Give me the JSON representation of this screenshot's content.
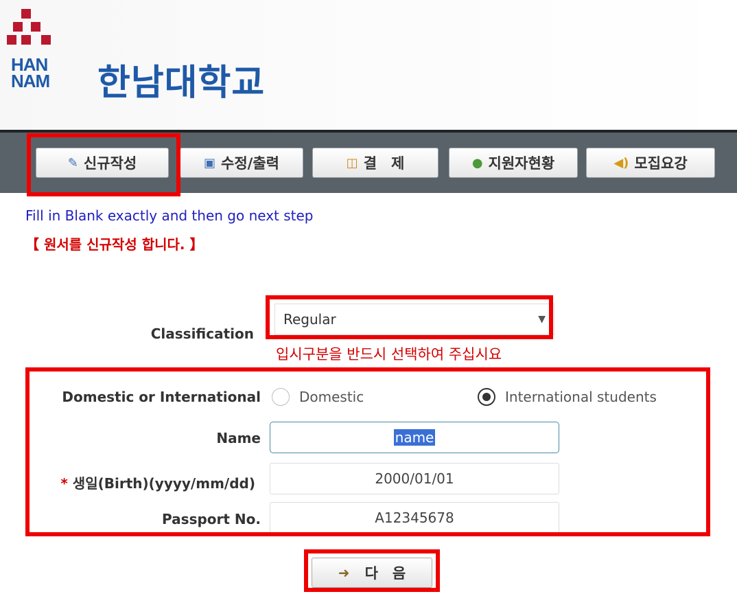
{
  "logo": {
    "abbr_line1": "HAN",
    "abbr_line2": "NAM",
    "name": "한남대학교",
    "brand_red": "#b9182f",
    "brand_blue": "#1f5aa8"
  },
  "toolbar": {
    "buttons": [
      {
        "label": "신규작성",
        "icon": "edit-icon"
      },
      {
        "label": "수정/출력",
        "icon": "document-edit-icon"
      },
      {
        "label": "결　제",
        "icon": "payment-icon"
      },
      {
        "label": "지원자현황",
        "icon": "people-icon"
      },
      {
        "label": "모집요강",
        "icon": "speaker-icon"
      }
    ]
  },
  "intro": {
    "english": "Fill in Blank exactly and then go next step",
    "korean": "【 원서를 신규작성 합니다. 】"
  },
  "form": {
    "classification": {
      "label": "Classification",
      "value": "Regular",
      "warning": "입시구분을 반드시 선택하여 주십시요"
    },
    "type": {
      "label": "Domestic or International",
      "options": [
        "Domestic",
        "International students"
      ],
      "selected": "International students"
    },
    "name": {
      "label": "Name",
      "value": "name"
    },
    "birth": {
      "required_mark": "*",
      "label": "생일(Birth)(yyyy/mm/dd)",
      "value": "2000/01/01"
    },
    "passport": {
      "label": "Passport No.",
      "value": "A12345678"
    }
  },
  "next_button": {
    "label": "다　음",
    "icon": "next-arrow-icon"
  },
  "colors": {
    "highlight": "#ee0000",
    "toolbar_bg": "#596269",
    "warning_text": "#d40000",
    "intro_text": "#2020c0"
  }
}
